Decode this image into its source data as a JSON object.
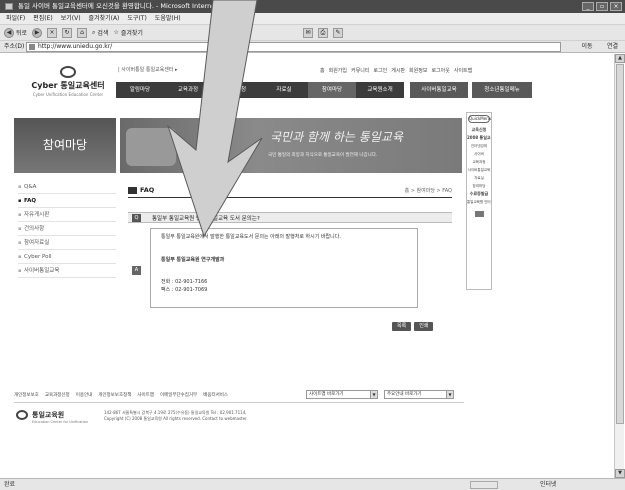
{
  "browser": {
    "title": "통일 사이버 통일교육센터에 오신것을 환영합니다. - Microsoft Internet Explorer",
    "window_buttons": [
      "_",
      "▫",
      "×"
    ],
    "menu": [
      "파일(F)",
      "편집(E)",
      "보기(V)",
      "즐겨찾기(A)",
      "도구(T)",
      "도움말(H)"
    ],
    "toolbar": {
      "back": "뒤로",
      "search": "검색",
      "favorites": "즐겨찾기"
    },
    "address_label": "주소(D)",
    "url": "http://www.uniedu.go.kr/",
    "go_label": "이동",
    "links_label": "연결",
    "status_left": "완료",
    "status_right": "인터넷"
  },
  "site": {
    "logo_name": "Cyber 통일교육센터",
    "logo_sub": "Cyber Unification Education Center",
    "top_note": "| 사이버통일 통일교육센터 ▸",
    "util_links": [
      "홈",
      "회원가입",
      "커뮤니티",
      "로그인",
      "게시판",
      "회원정보",
      "로그아웃",
      "사이트맵"
    ],
    "gnb": [
      "알림마당",
      "교육과정",
      "교육신청",
      "자료실",
      "참여마당",
      "교육원소개"
    ],
    "gnb_active_index": 4,
    "gnb_extra": [
      "사이버통일교육",
      "청소년통일메뉴"
    ]
  },
  "left": {
    "title": "참여마당",
    "items": [
      "Q&A",
      "FAQ",
      "자유게시판",
      "건의사항",
      "참여자료실",
      "Cyber Poll",
      "사이버통일교육"
    ],
    "active_index": 1
  },
  "banner": {
    "slogan": "국민과 함께 하는 통일교육",
    "desc": "국민 통일의 희망과 지식으로 통일교육이 발전해 나갑니다."
  },
  "content": {
    "title": "FAQ",
    "breadcrumb": "홈 > 참여마당 > FAQ",
    "question_mark": "Q",
    "question": "통일부 통일교육원 방행 통일교육 도서 문의는?",
    "answer_mark": "A",
    "answer_intro": "통일부 통일교육원에서 발행한 통일교육도서 문의는 아래의 발행처로 하시기 바랍니다.",
    "answer_org": "통일부 통일교육원 연구개발과",
    "answer_tel": "전화 : 02-901-7166",
    "answer_fax": "팩스 : 02-901-7069",
    "buttons": [
      "목록",
      "인쇄"
    ]
  },
  "quick": {
    "title": "QuickMenu",
    "items": [
      "교육신청",
      "2008 통일교육주간",
      "인터넷강좌",
      "사이버",
      "교육과정",
      "사이버통일교육",
      "자료실",
      "참여마당",
      "수료증발급",
      "통일교육원 인터넷 교육"
    ]
  },
  "footer": {
    "links": [
      "개인정보보호",
      "교육과정신청",
      "이용안내",
      "개인정보보호정책",
      "사이트맵",
      "이메일무단수집거부",
      "배움터서비스"
    ],
    "select1": "사이트맵 바로가기",
    "select2": "주요안내 바로가기",
    "logo_name": "통일교육원",
    "logo_sub": "Education Center for Unification",
    "address": "142-867 서울특별시 강북구 4.19로 275(수유동) 통일교육원 Tel : 02.901.7114,",
    "copyright": "Copyright (C) 2008 통일교육원 All rights reserved. Contact to webmaster."
  }
}
